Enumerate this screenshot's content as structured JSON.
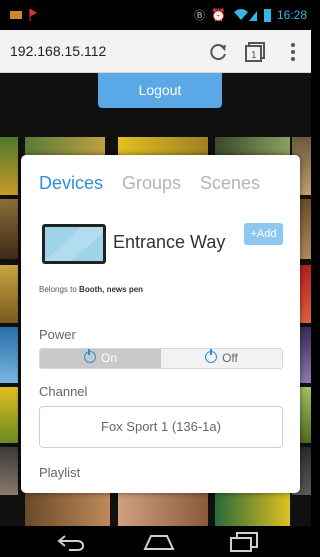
{
  "browser": {
    "url": "192.168.15.112"
  },
  "status_bar": {
    "time": "16:28"
  },
  "page": {
    "logout_label": "Logout"
  },
  "panel": {
    "tabs": [
      "Devices",
      "Groups",
      "Scenes"
    ],
    "active_tab": "Devices",
    "device_name": "Entrance Way",
    "add_label": "+Add",
    "belongs_prefix": "Belongs to",
    "belongs_groups": "Booth, news pen",
    "power_label": "Power",
    "power_on_label": "On",
    "power_off_label": "Off",
    "power_state": "On",
    "channel_label": "Channel",
    "channel_value": "Fox Sport 1 (136-1a)",
    "playlist_label": "Playlist"
  },
  "colors": {
    "accent": "#2f8fd6",
    "logout_bg": "#5aa9e6",
    "add_bg": "#8ec8f2",
    "status_icons": "#33b5e5"
  }
}
